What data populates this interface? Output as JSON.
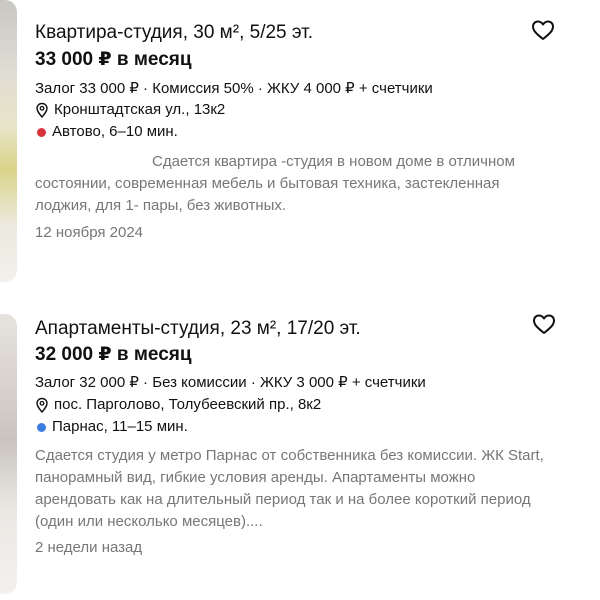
{
  "listings": [
    {
      "title": "Квартира-студия, 30 м², 5/25 эт.",
      "price": "33 000 ₽ в месяц",
      "terms": "Залог 33 000 ₽ · Комиссия 50% · ЖКУ 4 000 ₽ + счетчики",
      "address": "Кронштадтская ул., 13к2",
      "metro": "Автово, 6–10 мин.",
      "metro_color": "#d8323d",
      "description": "Сдается квартира -студия в новом доме в отличном состоянии, современная мебель и бытовая техника, застекленная лоджия, для 1- пары, без животных.",
      "date": "12 ноября 2024",
      "favorite_icon": "heart-icon"
    },
    {
      "title": "Апартаменты-студия, 23 м², 17/20 эт.",
      "price": "32 000 ₽ в месяц",
      "terms": "Залог 32 000 ₽ · Без комиссии · ЖКУ 3 000 ₽ + счетчики",
      "address": "пос. Парголово, Толубеевский пр., 8к2",
      "metro": "Парнас, 11–15 мин.",
      "metro_color": "#3b7de0",
      "description": "Сдается студия у метро Парнас от собственника без комиссии. ЖК Start, панорамный вид, гибкие условия аренды. Апартаменты можно арендовать как на длительный период так и на более короткий период (один или несколько месяцев)....",
      "date": "2 недели назад",
      "favorite_icon": "heart-icon"
    }
  ]
}
